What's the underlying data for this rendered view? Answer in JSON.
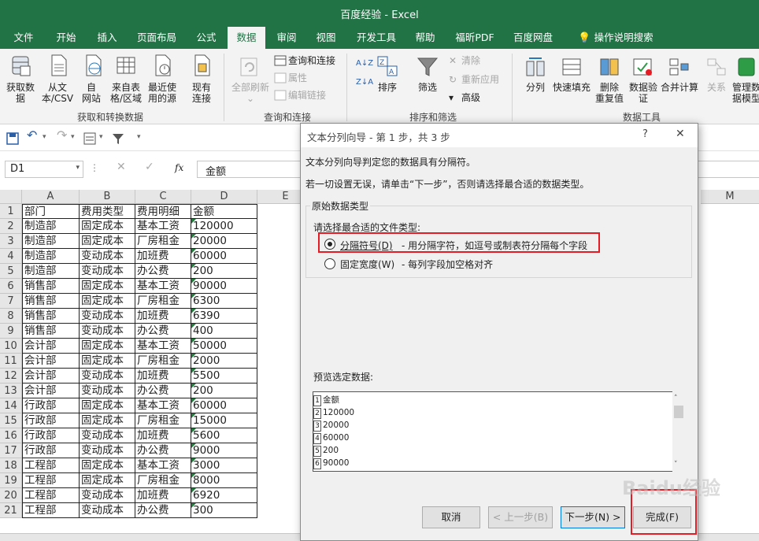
{
  "window": {
    "title": "百度经验  -  Excel"
  },
  "tabs": [
    "文件",
    "开始",
    "插入",
    "页面布局",
    "公式",
    "数据",
    "审阅",
    "视图",
    "开发工具",
    "帮助",
    "福昕PDF",
    "百度网盘",
    "操作说明搜索"
  ],
  "active_tab": "数据",
  "ribbon": {
    "get_data": [
      "获取数",
      "据"
    ],
    "from_csv": [
      "从文",
      "本/CSV"
    ],
    "from_web": [
      "自",
      "网站"
    ],
    "from_table": [
      "来自表",
      "格/区域"
    ],
    "recent_sources": [
      "最近使",
      "用的源"
    ],
    "existing_conn": [
      "现有",
      "连接"
    ],
    "group_get": "获取和转换数据",
    "refresh_all": "全部刷新",
    "queries_conn": "查询和连接",
    "properties": "属性",
    "edit_links": "编辑链接",
    "group_query": "查询和连接",
    "sort_az": "A↓Z",
    "sort_za": "Z↓A",
    "sort": "排序",
    "filter": "筛选",
    "clear": "清除",
    "reapply": "重新应用",
    "advanced": "高级",
    "group_sort": "排序和筛选",
    "text_to_columns": "分列",
    "flash_fill": "快速填充",
    "remove_dup": [
      "删除",
      "重复值"
    ],
    "validation": [
      "数据验",
      "证"
    ],
    "consolidate": "合并计算",
    "relationships": "关系",
    "manage_model": [
      "管理数",
      "据模型"
    ],
    "group_tools": "数据工具"
  },
  "formula_bar": {
    "namebox": "D1",
    "fx": "fx",
    "value": "金额"
  },
  "columns": [
    "A",
    "B",
    "C",
    "D",
    "E",
    "M"
  ],
  "rows": [
    [
      "部门",
      "费用类型",
      "费用明细",
      "金额"
    ],
    [
      "制造部",
      "固定成本",
      "基本工资",
      "120000"
    ],
    [
      "制造部",
      "固定成本",
      "厂房租金",
      "20000"
    ],
    [
      "制造部",
      "变动成本",
      "加班费",
      "60000"
    ],
    [
      "制造部",
      "变动成本",
      "办公费",
      "200"
    ],
    [
      "销售部",
      "固定成本",
      "基本工资",
      "90000"
    ],
    [
      "销售部",
      "固定成本",
      "厂房租金",
      "6300"
    ],
    [
      "销售部",
      "变动成本",
      "加班费",
      "6390"
    ],
    [
      "销售部",
      "变动成本",
      "办公费",
      "400"
    ],
    [
      "会计部",
      "固定成本",
      "基本工资",
      "50000"
    ],
    [
      "会计部",
      "固定成本",
      "厂房租金",
      "2000"
    ],
    [
      "会计部",
      "变动成本",
      "加班费",
      "5500"
    ],
    [
      "会计部",
      "变动成本",
      "办公费",
      "200"
    ],
    [
      "行政部",
      "固定成本",
      "基本工资",
      "60000"
    ],
    [
      "行政部",
      "固定成本",
      "厂房租金",
      "15000"
    ],
    [
      "行政部",
      "变动成本",
      "加班费",
      "5600"
    ],
    [
      "行政部",
      "变动成本",
      "办公费",
      "9000"
    ],
    [
      "工程部",
      "固定成本",
      "基本工资",
      "3000"
    ],
    [
      "工程部",
      "固定成本",
      "厂房租金",
      "8000"
    ],
    [
      "工程部",
      "变动成本",
      "加班费",
      "6920"
    ],
    [
      "工程部",
      "变动成本",
      "办公费",
      "300"
    ]
  ],
  "row_numbers": [
    "1",
    "2",
    "3",
    "4",
    "5",
    "6",
    "7",
    "8",
    "9",
    "10",
    "11",
    "12",
    "13",
    "14",
    "15",
    "16",
    "17",
    "18",
    "19",
    "20",
    "21"
  ],
  "sheet_tabs": [
    "(((成本",
    "类明细",
    "明细",
    "最高最低",
    "Sheet1",
    "Sheet2(2)",
    "详情图",
    "详细图(2)"
  ],
  "dialog": {
    "title": "文本分列向导 - 第 1 步，共 3 步",
    "help": "?",
    "close": "✕",
    "intro": "文本分列向导判定您的数据具有分隔符。",
    "hint": "若一切设置无误，请单击“下一步”，否则请选择最合适的数据类型。",
    "group_title": "原始数据类型",
    "choose_label": "请选择最合适的文件类型:",
    "delimited_label": "分隔符号(D)",
    "delimited_desc": "- 用分隔字符，如逗号或制表符分隔每个字段",
    "fixed_label": "固定宽度(W)",
    "fixed_desc": "- 每列字段加空格对齐",
    "preview_label": "预览选定数据:",
    "preview_lines": [
      "1金额",
      "2120000",
      "320000",
      "460000",
      "5200",
      "690000"
    ],
    "preview_nums": [
      "1",
      "2",
      "3",
      "4",
      "5",
      "6"
    ],
    "preview_vals": [
      "金额",
      "120000",
      "20000",
      "60000",
      "200",
      "90000"
    ],
    "cancel": "取消",
    "back": "< 上一步(B)",
    "next": "下一步(N) >",
    "finish": "完成(F)"
  },
  "watermark": "Baidu经验",
  "colors": {
    "excel_green": "#217346",
    "highlight_red": "#e51c23"
  }
}
